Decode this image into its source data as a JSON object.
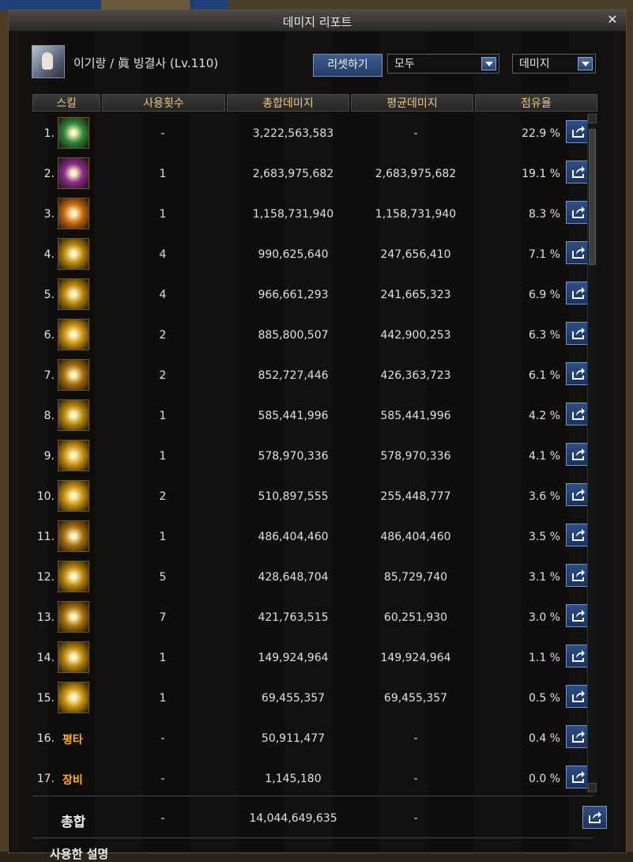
{
  "window": {
    "title": "데미지 리포트"
  },
  "character": {
    "info": "이기랑 / 眞 빙결사 (Lv.110)"
  },
  "controls": {
    "reset_label": "리셋하기",
    "filter_value": "모두",
    "metric_value": "데미지"
  },
  "columns": {
    "skill": "스킬",
    "uses": "사용횟수",
    "total": "총합데미지",
    "avg": "평균데미지",
    "share": "점유율"
  },
  "rows": [
    {
      "rank": "1.",
      "uses": "-",
      "total": "3,222,563,583",
      "avg": "-",
      "share": "22.9 %",
      "icon": "ice-burst-icon",
      "color": "#2f8a3a"
    },
    {
      "rank": "2.",
      "uses": "1",
      "total": "2,683,975,682",
      "avg": "2,683,975,682",
      "share": "19.1 %",
      "icon": "magic-web-icon",
      "color": "#8a2a8a"
    },
    {
      "rank": "3.",
      "uses": "1",
      "total": "1,158,731,940",
      "avg": "1,158,731,940",
      "share": "8.3 %",
      "icon": "shatter-icon",
      "color": "#c86a10"
    },
    {
      "rank": "4.",
      "uses": "4",
      "total": "990,625,640",
      "avg": "247,656,410",
      "share": "7.1 %",
      "icon": "spear-arc-icon",
      "color": "#b8860b"
    },
    {
      "rank": "5.",
      "uses": "4",
      "total": "966,661,293",
      "avg": "241,665,323",
      "share": "6.9 %",
      "icon": "lance-strike-icon",
      "color": "#b8860b"
    },
    {
      "rank": "6.",
      "uses": "2",
      "total": "885,800,507",
      "avg": "442,900,253",
      "share": "6.3 %",
      "icon": "star-burst-icon",
      "color": "#c89010"
    },
    {
      "rank": "7.",
      "uses": "2",
      "total": "852,727,446",
      "avg": "426,363,723",
      "share": "6.1 %",
      "icon": "flame-spike-icon",
      "color": "#a87010"
    },
    {
      "rank": "8.",
      "uses": "1",
      "total": "585,441,996",
      "avg": "585,441,996",
      "share": "4.2 %",
      "icon": "cross-slash-icon",
      "color": "#b8860b"
    },
    {
      "rank": "9.",
      "uses": "1",
      "total": "578,970,336",
      "avg": "578,970,336",
      "share": "4.1 %",
      "icon": "blade-flurry-icon",
      "color": "#c89010"
    },
    {
      "rank": "10.",
      "uses": "2",
      "total": "510,897,555",
      "avg": "255,448,777",
      "share": "3.6 %",
      "icon": "sun-star-icon",
      "color": "#c89010"
    },
    {
      "rank": "11.",
      "uses": "1",
      "total": "486,404,460",
      "avg": "486,404,460",
      "share": "3.5 %",
      "icon": "warrior-pose-icon",
      "color": "#a87010"
    },
    {
      "rank": "12.",
      "uses": "5",
      "total": "428,648,704",
      "avg": "85,729,740",
      "share": "3.1 %",
      "icon": "spinning-axe-icon",
      "color": "#b8860b"
    },
    {
      "rank": "13.",
      "uses": "7",
      "total": "421,763,515",
      "avg": "60,251,930",
      "share": "3.0 %",
      "icon": "multi-thrust-icon",
      "color": "#a87010"
    },
    {
      "rank": "14.",
      "uses": "1",
      "total": "149,924,964",
      "avg": "149,924,964",
      "share": "1.1 %",
      "icon": "rock-shard-icon",
      "color": "#b8860b"
    },
    {
      "rank": "15.",
      "uses": "1",
      "total": "69,455,357",
      "avg": "69,455,357",
      "share": "0.5 %",
      "icon": "laurel-icon",
      "color": "#c89010"
    },
    {
      "rank": "16.",
      "label": "평타",
      "uses": "-",
      "total": "50,911,477",
      "avg": "-",
      "share": "0.4 %"
    },
    {
      "rank": "17.",
      "label": "장비",
      "uses": "-",
      "total": "1,145,180",
      "avg": "-",
      "share": "0.0 %"
    }
  ],
  "total": {
    "label": "총합",
    "uses": "-",
    "total": "14,044,649,635",
    "avg": "-"
  },
  "footer": {
    "usage_label": "사용한 설명"
  }
}
